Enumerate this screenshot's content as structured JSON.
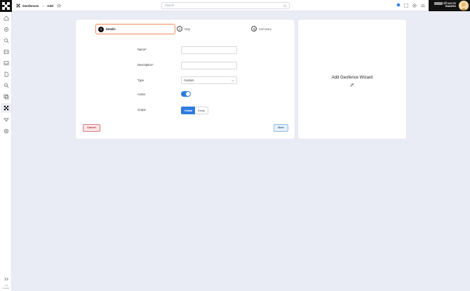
{
  "sidebar": {
    "items": [
      {
        "icon": "home-icon"
      },
      {
        "icon": "gear-icon"
      },
      {
        "icon": "search-icon"
      },
      {
        "icon": "grid-icon"
      },
      {
        "icon": "inbox-icon"
      },
      {
        "icon": "document-icon"
      },
      {
        "icon": "zoom-icon"
      },
      {
        "icon": "layers-icon"
      },
      {
        "icon": "geofences-icon",
        "active": true
      },
      {
        "icon": "routes-icon"
      },
      {
        "icon": "settings-cog-icon"
      }
    ],
    "expand_icon": "double-chevron-right-icon",
    "version": "v.24",
    "build": "01.2024"
  },
  "header": {
    "breadcrumb": [
      "Geofences",
      "Add"
    ],
    "favorite_icon": "star-icon",
    "search": {
      "placeholder": "Search"
    },
    "icons": [
      "status-dot-icon",
      "fullscreen-icon",
      "help-icon",
      "bell-icon"
    ],
    "user": {
      "name": "@haumlo",
      "org": "INAURO"
    }
  },
  "wizard": {
    "steps": [
      {
        "number": "1",
        "label": "Details",
        "active": true
      },
      {
        "number": "2",
        "label": "Map",
        "active": false
      },
      {
        "number": "3",
        "label": "Summary",
        "active": false
      }
    ],
    "form": {
      "name_label": "Name*",
      "name_value": "",
      "description_label": "Description*",
      "description_value": "",
      "type_label": "Type",
      "type_value": "Custom",
      "active_label": "Active",
      "active_value": true,
      "scope_label": "Scope",
      "scope_options": [
        "Global",
        "Group"
      ],
      "scope_selected": "Global"
    },
    "cancel_label": "Cancel",
    "next_label": "Next"
  },
  "side_panel": {
    "title": "Add Geofence Wizard",
    "icon": "magic-wand-icon"
  },
  "colors": {
    "accent": "#2f7be0",
    "active_step_border": "#f08a59",
    "cancel_bg": "#fbe4e6",
    "next_bg": "#e4f0fb",
    "page_bg": "#e9ecf4"
  }
}
